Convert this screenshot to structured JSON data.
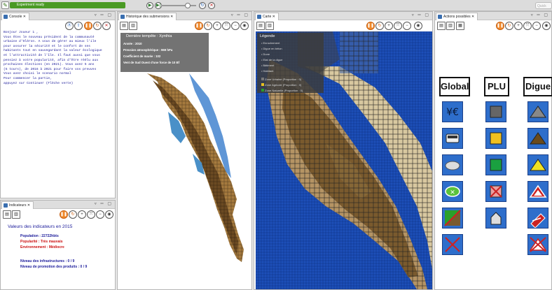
{
  "toolbar": {
    "status": "Experiment ready",
    "search_placeholder": "Quick",
    "run_icon": "play-icon",
    "step_icon": "step-icon"
  },
  "console": {
    "tab": "Console",
    "lines": [
      "Bonjour Joueur 1 ,",
      "Vous êtes le nouveau président de la communauté",
      "urbaine d'Oléron. A vous de gérer au mieux l'ile",
      "pour assurer la sécurité et le confort de ses",
      "habitants tout en sauvegardant la valeur écologique",
      "et l'attractivité de l'île. Il faut aussi que vous",
      "pensiez à votre popularité, afin d'être réélu aux",
      "prochaines élections (en 2021). Vous avez 5 ans",
      "(5 tours), de 2016 à 2021 pour faire vos preuves",
      "Vous avez choisi le scenario normal",
      "Pour commencer la partie,",
      "appuyez sur Continuer (Flèche verte)"
    ]
  },
  "indicators": {
    "tab": "Indicateurs",
    "title": "Valeurs des indicateurs en 2015",
    "population": "Population : 22722hbts",
    "popularity": "Popularité : Très mauvais",
    "environment": "Environnement : Médiocre",
    "infrastructure": "Niveau des infrastructures : 0 / 9",
    "promotion": "Niveau de promotion des produits : 0 / 9"
  },
  "history": {
    "tab": "Historique des submersions",
    "storm_title": "Dernière tempête : Xynthia",
    "year": "Année : 2010",
    "pressure": "Pression atmosphérique : 969 hPa",
    "tide": "Coefficient de marée : 102",
    "wind": "Vent de Sud Ouest d'une force de 10 Bf"
  },
  "carte": {
    "tab": "Carte",
    "legend_title": "Légende",
    "legend": [
      "Enrochement",
      "Digue en béton",
      "Dune",
      "Etat de la digue",
      "Bâtiment",
      "Habitant"
    ],
    "zones": [
      "Zone Urbaine (Proportion : 0)",
      "Zone Agricole (Proportion : 0)",
      "Zone Naturelle (Proportion : 0)"
    ]
  },
  "actions": {
    "tab": "Actions possibles",
    "headers": [
      "Global",
      "PLU",
      "Digue"
    ]
  },
  "colors": {
    "sea": "#1d4fb8",
    "accent": "#2e6ecb",
    "status": "#4a9a24",
    "red_text": "#cc1111"
  }
}
